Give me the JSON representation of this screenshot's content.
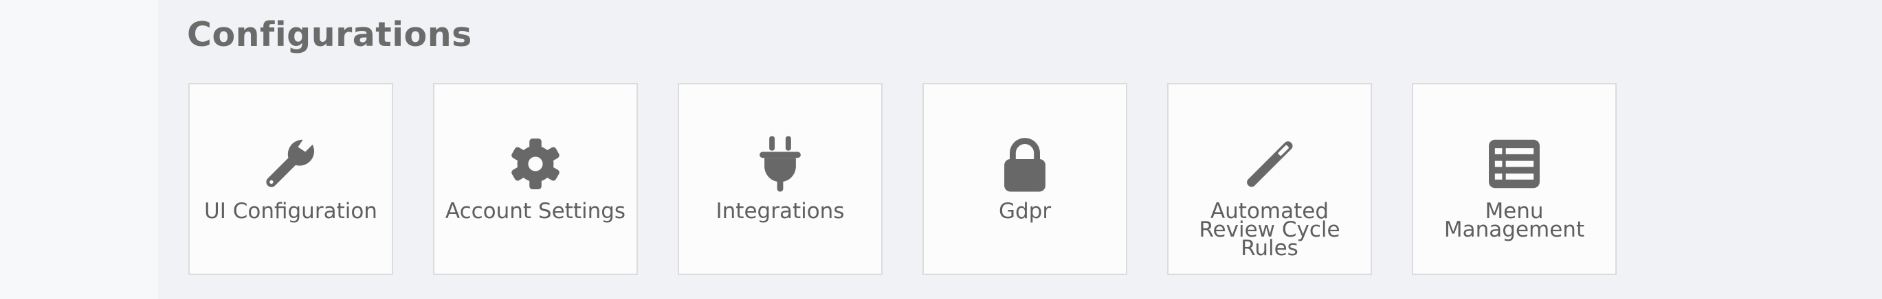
{
  "header": {
    "title": "Configurations"
  },
  "cards": [
    {
      "label": "UI Configuration",
      "icon": "wrench-icon"
    },
    {
      "label": "Account Settings",
      "icon": "gear-icon"
    },
    {
      "label": "Integrations",
      "icon": "plug-icon"
    },
    {
      "label": "Gdpr",
      "icon": "lock-icon"
    },
    {
      "label": "Automated Review Cycle Rules",
      "icon": "magic-wand-icon"
    },
    {
      "label": "Menu Management",
      "icon": "list-icon"
    }
  ],
  "colors": {
    "page_background": "#f1f2f5",
    "card_background": "#fcfcfc",
    "card_border": "#dcdcdc",
    "icon": "#686868",
    "text": "#5f5f5f"
  }
}
